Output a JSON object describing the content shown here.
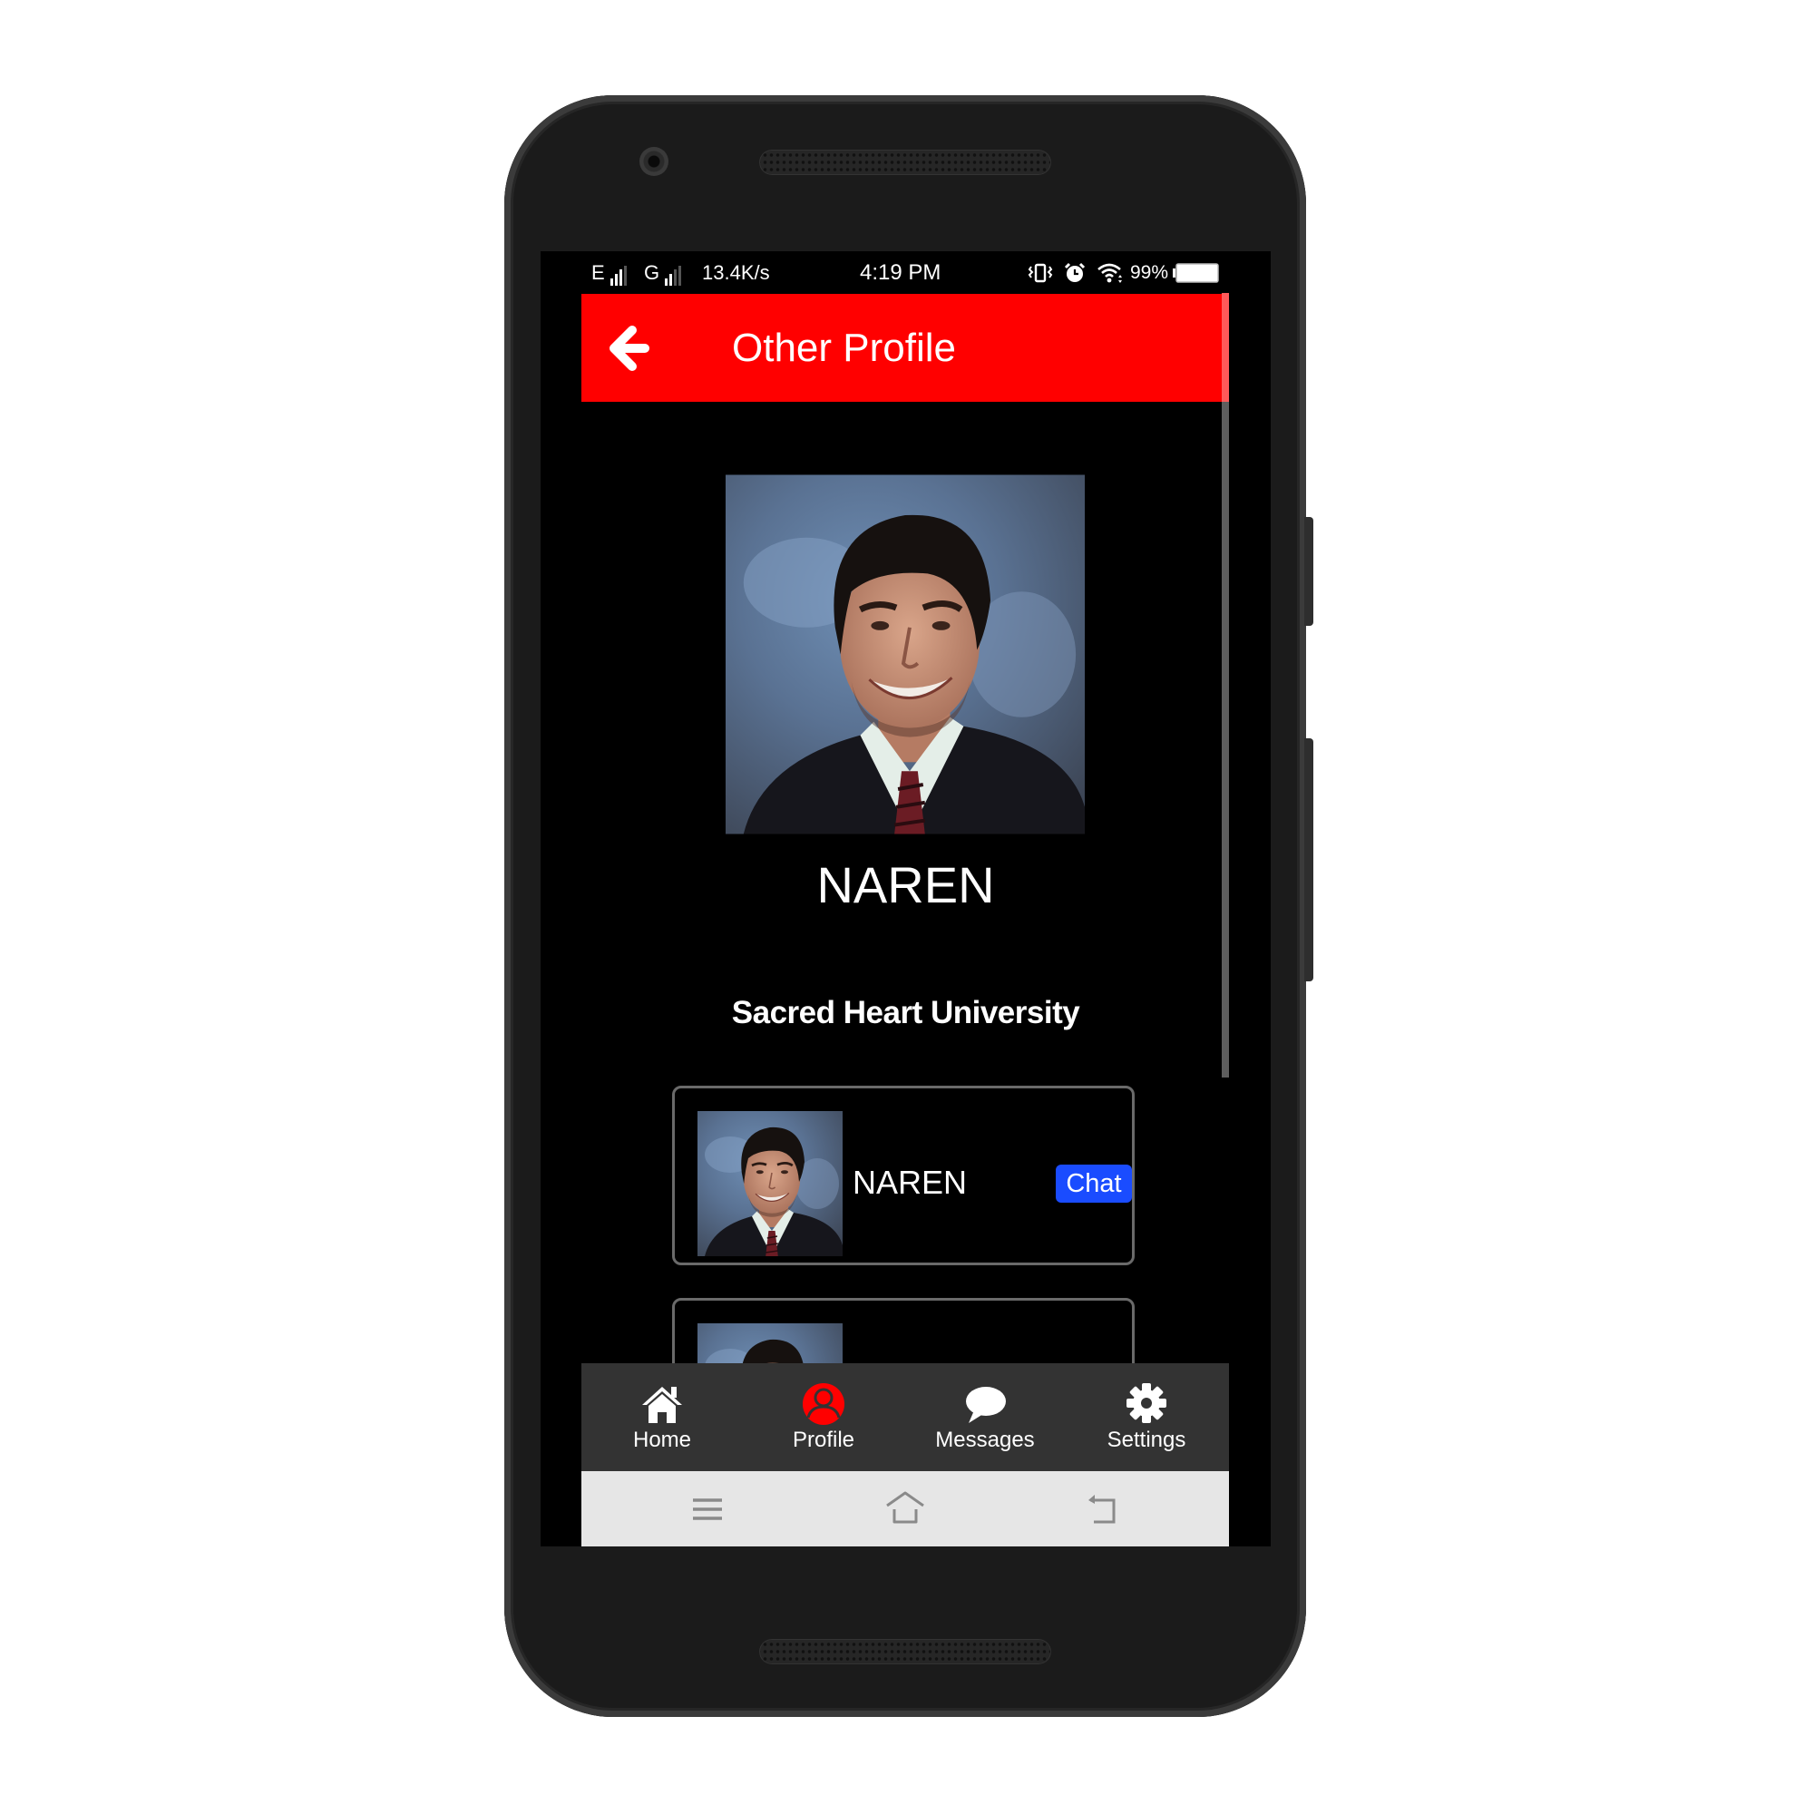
{
  "status_bar": {
    "carrier1": "E",
    "carrier2": "G",
    "speed": "13.4K/s",
    "time": "4:19 PM",
    "battery": "99%",
    "icons": [
      "signal-icon",
      "vibrate-icon",
      "alarm-icon",
      "wifi-icon",
      "battery-icon"
    ]
  },
  "header": {
    "title": "Other Profile",
    "back_icon": "arrow-left-icon",
    "color": "#ff0000"
  },
  "profile": {
    "name": "NAREN",
    "university": "Sacred Heart University",
    "photo": "profile-portrait"
  },
  "list": [
    {
      "name": "NAREN",
      "action": "Chat"
    },
    {
      "name": "",
      "action": ""
    }
  ],
  "bottom_nav": {
    "active": "Profile",
    "active_color": "#ff0000",
    "items": [
      {
        "label": "Home",
        "icon": "home-icon"
      },
      {
        "label": "Profile",
        "icon": "user-icon"
      },
      {
        "label": "Messages",
        "icon": "chat-bubble-icon"
      },
      {
        "label": "Settings",
        "icon": "gear-icon"
      }
    ]
  },
  "system_nav": {
    "items": [
      "menu-icon",
      "home-outline-icon",
      "back-icon"
    ]
  },
  "colors": {
    "chat_button": "#1a4cff",
    "nav_background": "#333333"
  }
}
